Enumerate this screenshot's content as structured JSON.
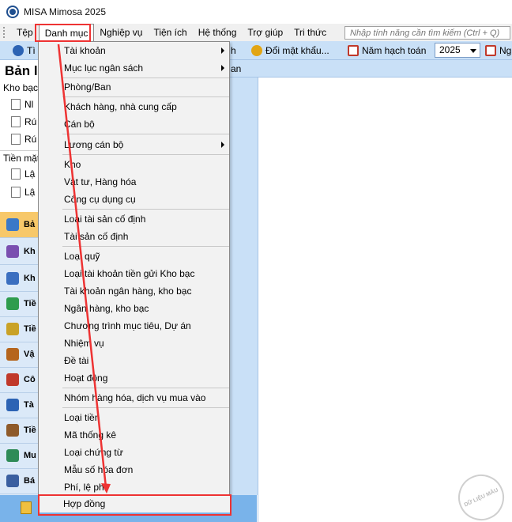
{
  "window": {
    "title": "MISA Mimosa 2025"
  },
  "menubar": {
    "items": [
      "Tệp",
      "Danh mục",
      "Nghiệp vụ",
      "Tiện ích",
      "Hệ thống",
      "Trợ giúp",
      "Tri thức"
    ],
    "search_placeholder": "Nhập tính năng cần tìm kiếm (Ctrl + Q)"
  },
  "toolbar": {
    "search_label": "Tì",
    "h_label": "h",
    "change_password": "Đổi mật khẩu...",
    "fiscal_year_label": "Năm hạch toán",
    "year": "2025",
    "next_label": "Ng"
  },
  "subbar": {
    "text": "an"
  },
  "left_panel": {
    "title": "Bản l",
    "group1": "Kho bạc",
    "group1_items": [
      "Nl",
      "Rú",
      "Rú"
    ],
    "group2": "Tiền mặt",
    "group2_items": [
      "Lậ",
      "Lậ"
    ]
  },
  "nav": {
    "items": [
      "Bả",
      "Kh",
      "Kh",
      "Tiề",
      "Tiề",
      "Vậ",
      "Cô",
      "Tà",
      "Tiề",
      "Mu",
      "Bá"
    ],
    "colors": [
      "#3a78c8",
      "#7a4fb0",
      "#3b6fc0",
      "#2e9c4d",
      "#c9a227",
      "#b5651d",
      "#c0392b",
      "#2c63b4",
      "#8e5a2a",
      "#2e8b57",
      "#3a5fa0"
    ]
  },
  "dropdown": {
    "items": [
      "Tài khoản",
      "Mục lục ngân sách",
      "Phòng/Ban",
      "Khách hàng, nhà cung cấp",
      "Cán bộ",
      "Lương cán bộ",
      "Kho",
      "Vật tư, Hàng hóa",
      "Công cụ dụng cụ",
      "Loại tài sản cố định",
      "Tài sản cố định",
      "Loại quỹ",
      "Loại tài khoản tiền gửi Kho bạc",
      "Tài khoản ngân hàng, kho bạc",
      "Ngân hàng, kho bạc",
      "Chương trình mục tiêu, Dự án",
      "Nhiệm vụ",
      "Đề tài",
      "Hoạt động",
      "Nhóm hàng hóa, dịch vụ mua vào",
      "Loại tiền",
      "Mã thống kê",
      "Loại chứng từ",
      "Mẫu số hóa đơn",
      "Phí, lệ phí",
      "Hợp đồng"
    ]
  },
  "watermark": {
    "text": "DỮ LIỆU MẪU"
  },
  "accent": "#e33333"
}
